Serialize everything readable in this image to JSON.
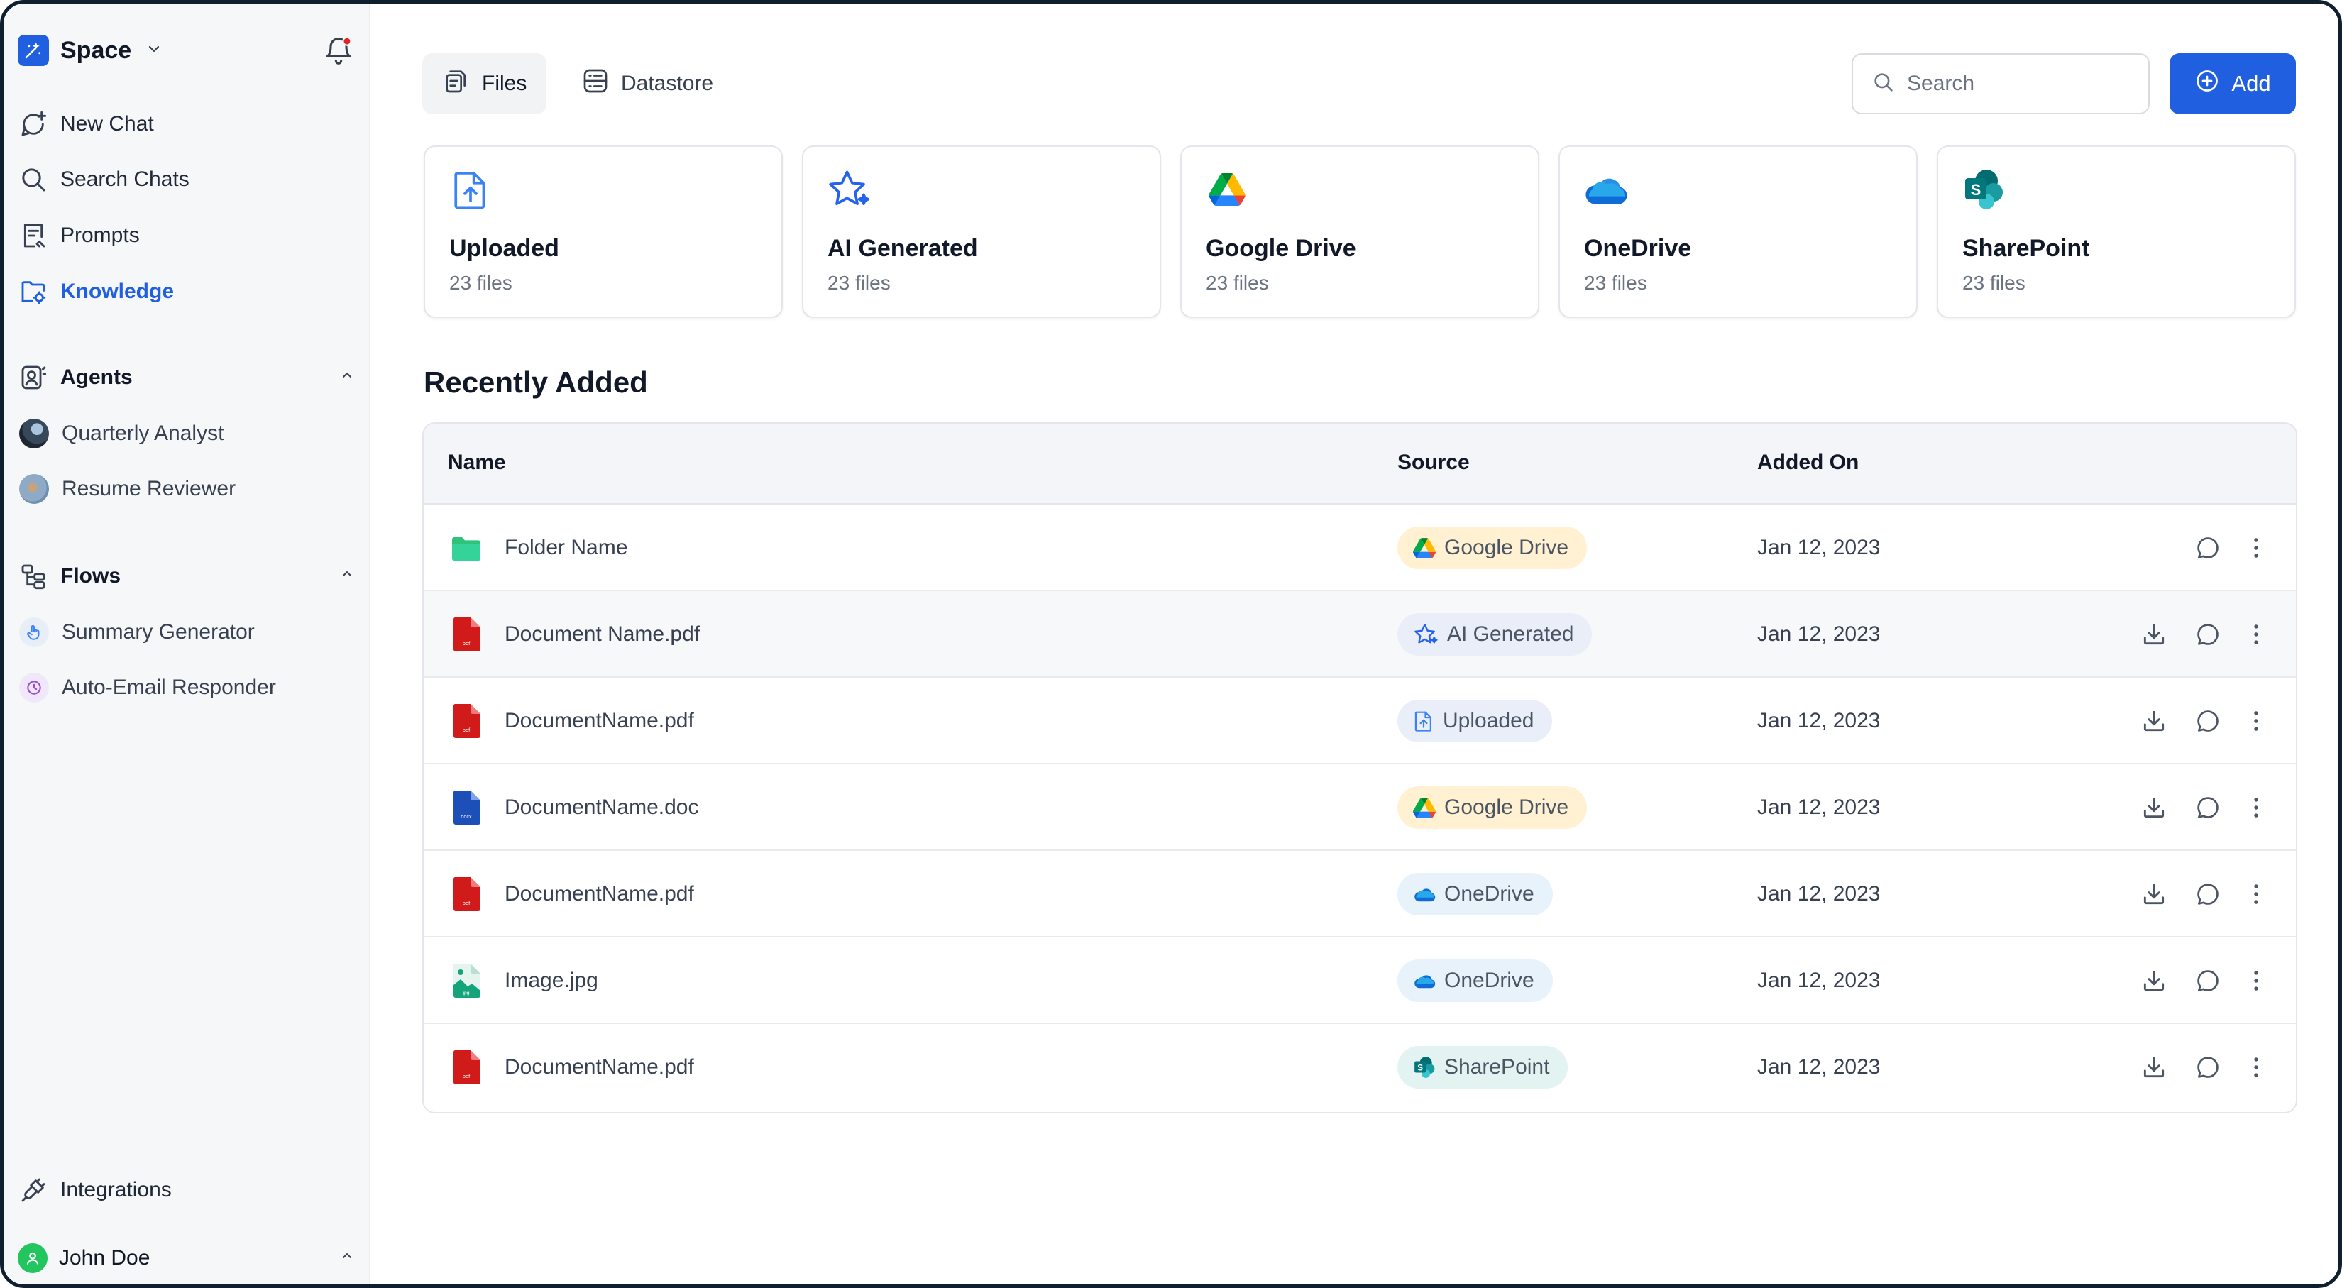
{
  "sidebar": {
    "brand": "Space",
    "nav": [
      {
        "label": "New Chat",
        "icon": "chat-plus-icon"
      },
      {
        "label": "Search Chats",
        "icon": "search-icon"
      },
      {
        "label": "Prompts",
        "icon": "prompt-icon"
      },
      {
        "label": "Knowledge",
        "icon": "knowledge-icon",
        "active": true
      }
    ],
    "agents": {
      "title": "Agents",
      "items": [
        {
          "label": "Quarterly Analyst"
        },
        {
          "label": "Resume Reviewer"
        }
      ]
    },
    "flows": {
      "title": "Flows",
      "items": [
        {
          "label": "Summary Generator"
        },
        {
          "label": "Auto-Email Responder"
        }
      ]
    },
    "integrations": "Integrations",
    "user": "John Doe"
  },
  "toolbar": {
    "tabs": [
      {
        "label": "Files",
        "active": true
      },
      {
        "label": "Datastore",
        "active": false
      }
    ],
    "search_placeholder": "Search",
    "add_label": "Add"
  },
  "sources": [
    {
      "title": "Uploaded",
      "count": "23 files",
      "icon": "upload-icon"
    },
    {
      "title": "AI Generated",
      "count": "23 files",
      "icon": "ai-star-icon"
    },
    {
      "title": "Google Drive",
      "count": "23 files",
      "icon": "google-drive-icon"
    },
    {
      "title": "OneDrive",
      "count": "23 files",
      "icon": "onedrive-icon"
    },
    {
      "title": "SharePoint",
      "count": "23 files",
      "icon": "sharepoint-icon"
    }
  ],
  "recent": {
    "title": "Recently Added",
    "columns": [
      "Name",
      "Source",
      "Added On"
    ],
    "rows": [
      {
        "name": "Folder Name",
        "type": "folder",
        "source": "Google Drive",
        "date": "Jan 12, 2023"
      },
      {
        "name": "Document Name.pdf",
        "type": "pdf",
        "source": "AI Generated",
        "date": "Jan 12, 2023"
      },
      {
        "name": "DocumentName.pdf",
        "type": "pdf",
        "source": "Uploaded",
        "date": "Jan 12, 2023"
      },
      {
        "name": "DocumentName.doc",
        "type": "docx",
        "source": "Google Drive",
        "date": "Jan 12, 2023"
      },
      {
        "name": "DocumentName.pdf",
        "type": "pdf",
        "source": "OneDrive",
        "date": "Jan 12, 2023"
      },
      {
        "name": "Image.jpg",
        "type": "jpg",
        "source": "OneDrive",
        "date": "Jan 12, 2023"
      },
      {
        "name": "DocumentName.pdf",
        "type": "pdf",
        "source": "SharePoint",
        "date": "Jan 12, 2023"
      }
    ]
  },
  "colors": {
    "accent": "#1f5fe0",
    "google_drive_chip": "#fff1d1",
    "onedrive_chip": "#e8f2fb",
    "sharepoint_chip": "#e3f3f1",
    "pdf_red": "#d11a1a",
    "folder_green": "#2fc27a",
    "notification_dot": "#e02424"
  }
}
